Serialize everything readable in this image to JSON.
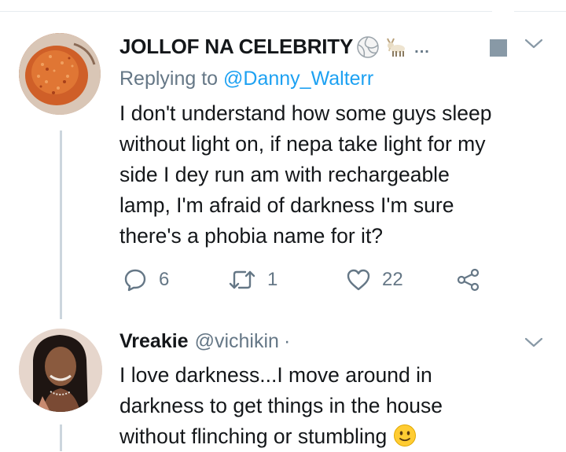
{
  "tweet1": {
    "display_name": "JOLLOF NA CELEBRITY",
    "emojis": [
      "volleyball-icon",
      "goat-icon"
    ],
    "more": "...",
    "replying_prefix": "Replying to ",
    "replying_handle": "@Danny_Walterr",
    "text_lines": [
      "I don't understand how some guys sleep",
      "without light on, if nepa take light for my",
      "side I dey run am with rechargeable",
      "lamp, I'm afraid of darkness I'm sure",
      "there's a phobia name for it?"
    ],
    "replies": "6",
    "retweets": "1",
    "likes": "22"
  },
  "tweet2": {
    "display_name": "Vreakie",
    "handle": "@vichikin",
    "separator": "·",
    "text_lines": [
      "I love darkness...I move around in",
      "darkness to get things in the house",
      "without flinching or stumbling"
    ],
    "trailing_emoji": "slightly-smiling-face-icon"
  },
  "colors": {
    "text": "#14171a",
    "muted": "#657786",
    "link": "#1da1f2",
    "thread_line": "#ccd6dd",
    "divider": "#e6ecf0"
  }
}
